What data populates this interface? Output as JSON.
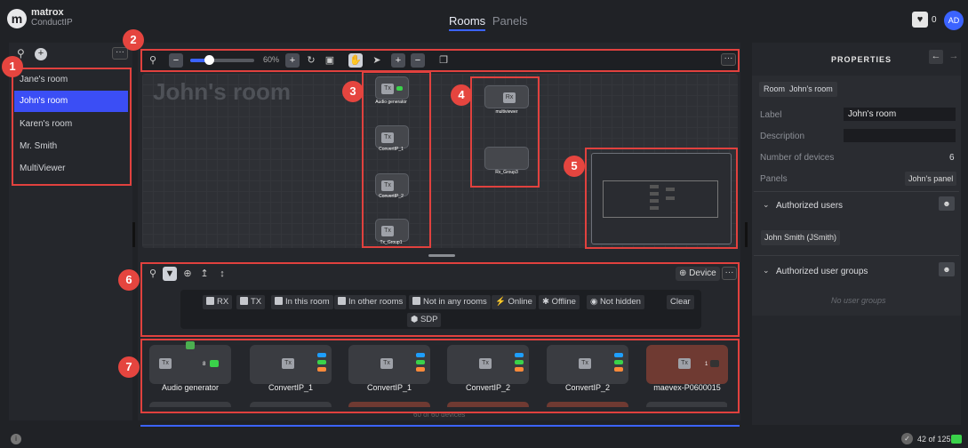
{
  "header": {
    "brand": "matrox",
    "product": "ConductIP",
    "tabs": [
      "Rooms",
      "Panels"
    ],
    "notifications": "0",
    "avatar": "AD"
  },
  "sidebar": {
    "rooms": [
      "Jane's room",
      "John's room",
      "Karen's room",
      "Mr. Smith",
      "MultiViewer"
    ],
    "selected": "John's room"
  },
  "toolbar": {
    "zoom": "60%"
  },
  "canvas": {
    "title": "John's room",
    "nodes_left": [
      "Audio generator",
      "ConvertIP_1",
      "ConvertIP_2",
      "Tx_Group1"
    ],
    "nodes_right": [
      "multiviewer",
      "Rx_Group3"
    ]
  },
  "filters": {
    "device_button": "Device",
    "chips": [
      "RX",
      "TX",
      "In this room",
      "In other rooms",
      "Not in any rooms",
      "Online",
      "Offline",
      "Not hidden"
    ],
    "clear": "Clear",
    "sdp": "SDP"
  },
  "devices": [
    {
      "name": "Audio generator",
      "count": "8"
    },
    {
      "name": "ConvertIP_1"
    },
    {
      "name": "ConvertIP_1"
    },
    {
      "name": "ConvertIP_2"
    },
    {
      "name": "ConvertIP_2"
    },
    {
      "name": "maevex-P0600015",
      "count": "1"
    }
  ],
  "device_count_text": "60 of 60 devices",
  "properties": {
    "header": "PROPERTIES",
    "room_tag": "Room",
    "room_name": "John's room",
    "label_label": "Label",
    "label_value": "John's room",
    "description_label": "Description",
    "num_devices_label": "Number of devices",
    "num_devices_value": "6",
    "panels_label": "Panels",
    "panels_value": "John's panel",
    "authorized_users": "Authorized users",
    "user_chip": "John Smith (JSmith)",
    "authorized_groups": "Authorized user groups",
    "no_groups": "No user groups"
  },
  "footer": {
    "status": "42 of 125"
  },
  "badges": [
    "1",
    "2",
    "3",
    "4",
    "5",
    "6",
    "7"
  ],
  "colors": {
    "accent": "#3b4ef5",
    "annotation": "#e1413e"
  }
}
